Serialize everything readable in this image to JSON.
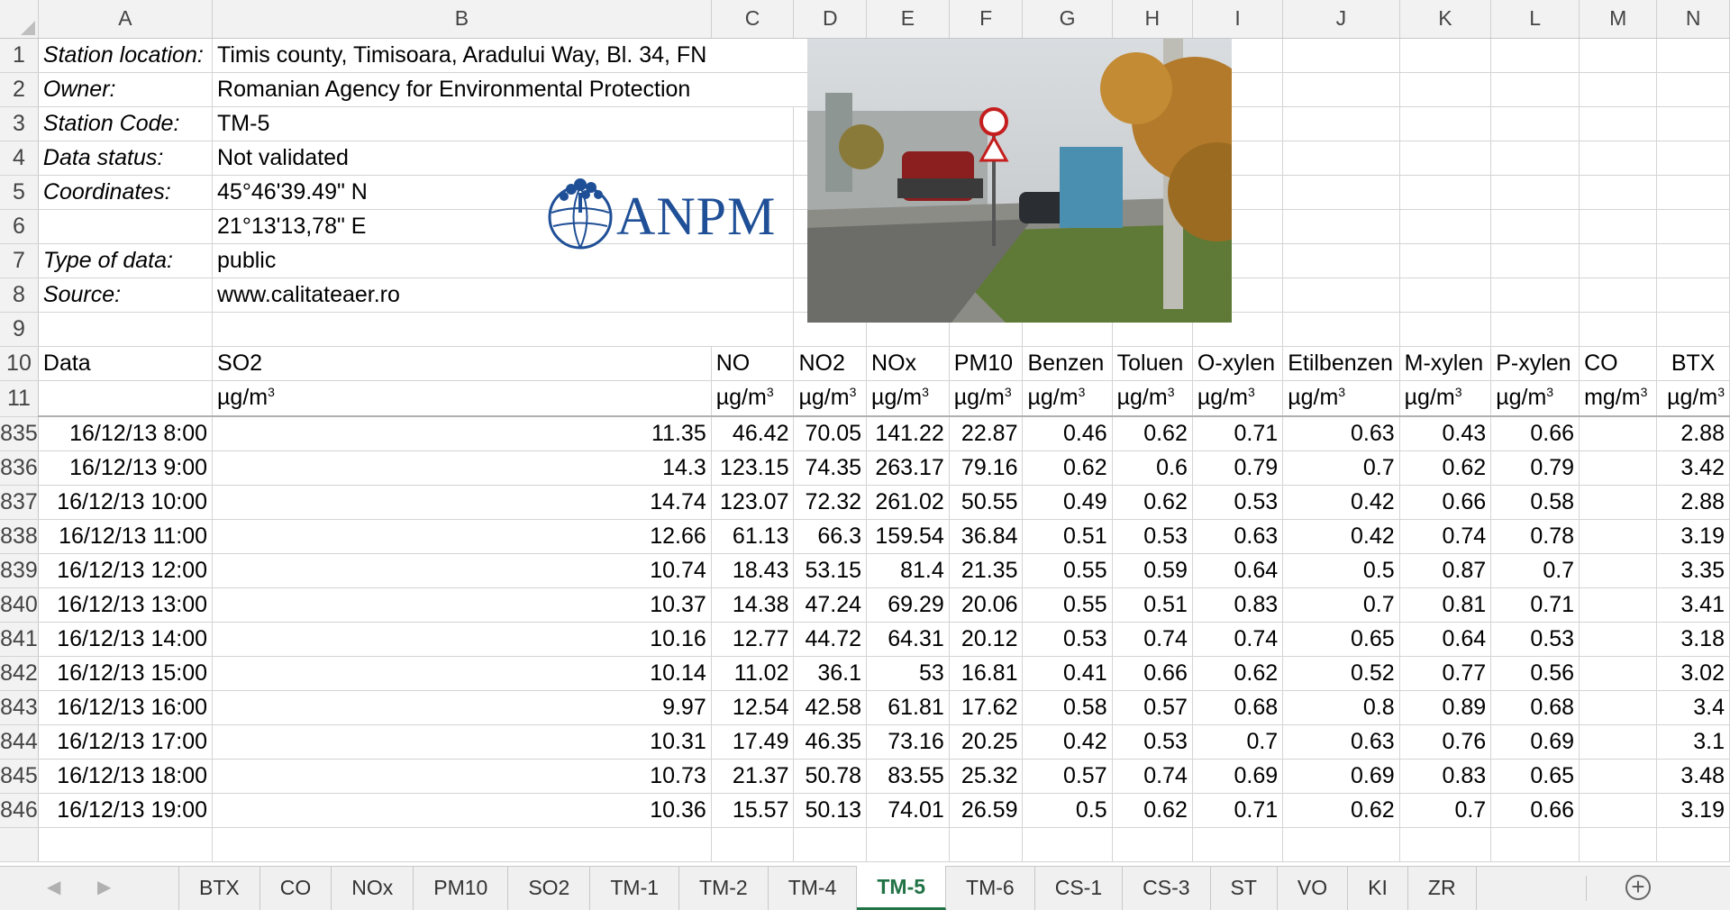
{
  "columns": [
    "A",
    "B",
    "C",
    "D",
    "E",
    "F",
    "G",
    "H",
    "I",
    "J",
    "K",
    "L",
    "M",
    "N"
  ],
  "info_rows": [
    {
      "row": "1",
      "label": "Station location:",
      "value": "Timis county, Timisoara, Aradului Way, Bl. 34, FN"
    },
    {
      "row": "2",
      "label": "Owner:",
      "value": "Romanian Agency for Environmental Protection"
    },
    {
      "row": "3",
      "label": "Station Code:",
      "value": "TM-5"
    },
    {
      "row": "4",
      "label": "Data status:",
      "value": "Not validated"
    },
    {
      "row": "5",
      "label": "Coordinates:",
      "value": "45°46'39.49\" N"
    },
    {
      "row": "6",
      "label": "",
      "value": "21°13'13,78\" E"
    },
    {
      "row": "7",
      "label": "Type of data:",
      "value": "public"
    },
    {
      "row": "8",
      "label": "Source:",
      "value": "www.calitateaer.ro"
    },
    {
      "row": "9",
      "label": "",
      "value": ""
    }
  ],
  "header_row": {
    "row": "10",
    "cells": [
      "Data",
      "SO2",
      "NO",
      "NO2",
      "NOx",
      "PM10",
      "Benzen",
      "Toluen",
      "O-xylen",
      "Etilbenzen",
      "M-xylen",
      "P-xylen",
      "CO",
      "BTX"
    ]
  },
  "unit_row": {
    "row": "11",
    "unit_base": "µg/m",
    "co_base": "mg/m",
    "exponent": "3"
  },
  "data_rows": [
    {
      "row": "835",
      "cells": [
        "16/12/13 8:00",
        "11.35",
        "46.42",
        "70.05",
        "141.22",
        "22.87",
        "0.46",
        "0.62",
        "0.71",
        "0.63",
        "0.43",
        "0.66",
        "",
        "2.88"
      ]
    },
    {
      "row": "836",
      "cells": [
        "16/12/13 9:00",
        "14.3",
        "123.15",
        "74.35",
        "263.17",
        "79.16",
        "0.62",
        "0.6",
        "0.79",
        "0.7",
        "0.62",
        "0.79",
        "",
        "3.42"
      ]
    },
    {
      "row": "837",
      "cells": [
        "16/12/13 10:00",
        "14.74",
        "123.07",
        "72.32",
        "261.02",
        "50.55",
        "0.49",
        "0.62",
        "0.53",
        "0.42",
        "0.66",
        "0.58",
        "",
        "2.88"
      ]
    },
    {
      "row": "838",
      "cells": [
        "16/12/13 11:00",
        "12.66",
        "61.13",
        "66.3",
        "159.54",
        "36.84",
        "0.51",
        "0.53",
        "0.63",
        "0.42",
        "0.74",
        "0.78",
        "",
        "3.19"
      ]
    },
    {
      "row": "839",
      "cells": [
        "16/12/13 12:00",
        "10.74",
        "18.43",
        "53.15",
        "81.4",
        "21.35",
        "0.55",
        "0.59",
        "0.64",
        "0.5",
        "0.87",
        "0.7",
        "",
        "3.35"
      ]
    },
    {
      "row": "840",
      "cells": [
        "16/12/13 13:00",
        "10.37",
        "14.38",
        "47.24",
        "69.29",
        "20.06",
        "0.55",
        "0.51",
        "0.83",
        "0.7",
        "0.81",
        "0.71",
        "",
        "3.41"
      ]
    },
    {
      "row": "841",
      "cells": [
        "16/12/13 14:00",
        "10.16",
        "12.77",
        "44.72",
        "64.31",
        "20.12",
        "0.53",
        "0.74",
        "0.74",
        "0.65",
        "0.64",
        "0.53",
        "",
        "3.18"
      ]
    },
    {
      "row": "842",
      "cells": [
        "16/12/13 15:00",
        "10.14",
        "11.02",
        "36.1",
        "53",
        "16.81",
        "0.41",
        "0.66",
        "0.62",
        "0.52",
        "0.77",
        "0.56",
        "",
        "3.02"
      ]
    },
    {
      "row": "843",
      "cells": [
        "16/12/13 16:00",
        "9.97",
        "12.54",
        "42.58",
        "61.81",
        "17.62",
        "0.58",
        "0.57",
        "0.68",
        "0.8",
        "0.89",
        "0.68",
        "",
        "3.4"
      ]
    },
    {
      "row": "844",
      "cells": [
        "16/12/13 17:00",
        "10.31",
        "17.49",
        "46.35",
        "73.16",
        "20.25",
        "0.42",
        "0.53",
        "0.7",
        "0.63",
        "0.76",
        "0.69",
        "",
        "3.1"
      ]
    },
    {
      "row": "845",
      "cells": [
        "16/12/13 18:00",
        "10.73",
        "21.37",
        "50.78",
        "83.55",
        "25.32",
        "0.57",
        "0.74",
        "0.69",
        "0.69",
        "0.83",
        "0.65",
        "",
        "3.48"
      ]
    },
    {
      "row": "846",
      "cells": [
        "16/12/13 19:00",
        "10.36",
        "15.57",
        "50.13",
        "74.01",
        "26.59",
        "0.5",
        "0.62",
        "0.71",
        "0.62",
        "0.7",
        "0.66",
        "",
        "3.19"
      ]
    }
  ],
  "logo": {
    "text": "ANPM",
    "color": "#1f4f96"
  },
  "sheet_tabs": [
    "BTX",
    "CO",
    "NOx",
    "PM10",
    "SO2",
    "TM-1",
    "TM-2",
    "TM-4",
    "TM-5",
    "TM-6",
    "CS-1",
    "CS-3",
    "ST",
    "VO",
    "KI",
    "ZR"
  ],
  "active_tab": "TM-5",
  "icons": {
    "prev": "◀",
    "next": "▶",
    "add": "+"
  },
  "colors": {
    "accent": "#217346",
    "header_bg": "#f2f2f2",
    "grid": "#d4d4d4"
  }
}
